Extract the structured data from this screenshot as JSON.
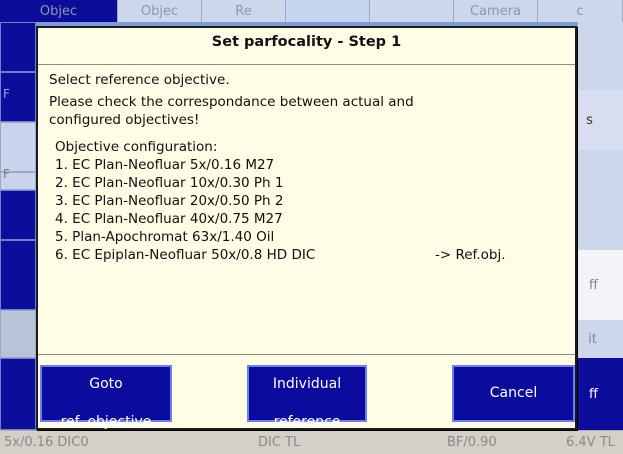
{
  "background": {
    "tabs": [
      {
        "label": "Objec"
      },
      {
        "label": "Re"
      },
      {
        "label": ""
      },
      {
        "label": ""
      },
      {
        "label": "Camera"
      },
      {
        "label": "c"
      }
    ],
    "left_letters": [
      "F",
      "F"
    ],
    "right_labels": [
      "s",
      "ff",
      "it",
      "ff"
    ],
    "status": {
      "objective": "5x/0.16 DIC0",
      "reflector": "DIC TL",
      "condenser": "BF/0.90",
      "lamp": "6.4V TL"
    }
  },
  "dialog": {
    "title": "Set parfocality - Step 1",
    "instruction": "Select reference objective.",
    "warning_line1": "Please check the correspondance between actual and",
    "warning_line2": "configured objectives!",
    "config_heading": "Objective configuration:",
    "objectives": [
      "1. EC Plan-Neofluar 5x/0.16 M27",
      "2. EC Plan-Neofluar 10x/0.30 Ph 1",
      "3. EC Plan-Neofluar 20x/0.50 Ph 2",
      "4. EC Plan-Neofluar 40x/0.75 M27",
      "5. Plan-Apochromat 63x/1.40 Oil",
      "6. EC Epiplan-Neofluar 50x/0.8 HD DIC"
    ],
    "reference_marker": "-> Ref.obj.",
    "buttons": {
      "goto_line1": "Goto",
      "goto_line2": "ref. objective",
      "individual_line1": "Individual",
      "individual_line2": "reference",
      "cancel": "Cancel"
    }
  },
  "colors": {
    "dialog_bg": "#fffde6",
    "button_bg": "#0b0b9e",
    "button_border": "#6d7ff0",
    "backdrop": "#7b9cd6"
  }
}
